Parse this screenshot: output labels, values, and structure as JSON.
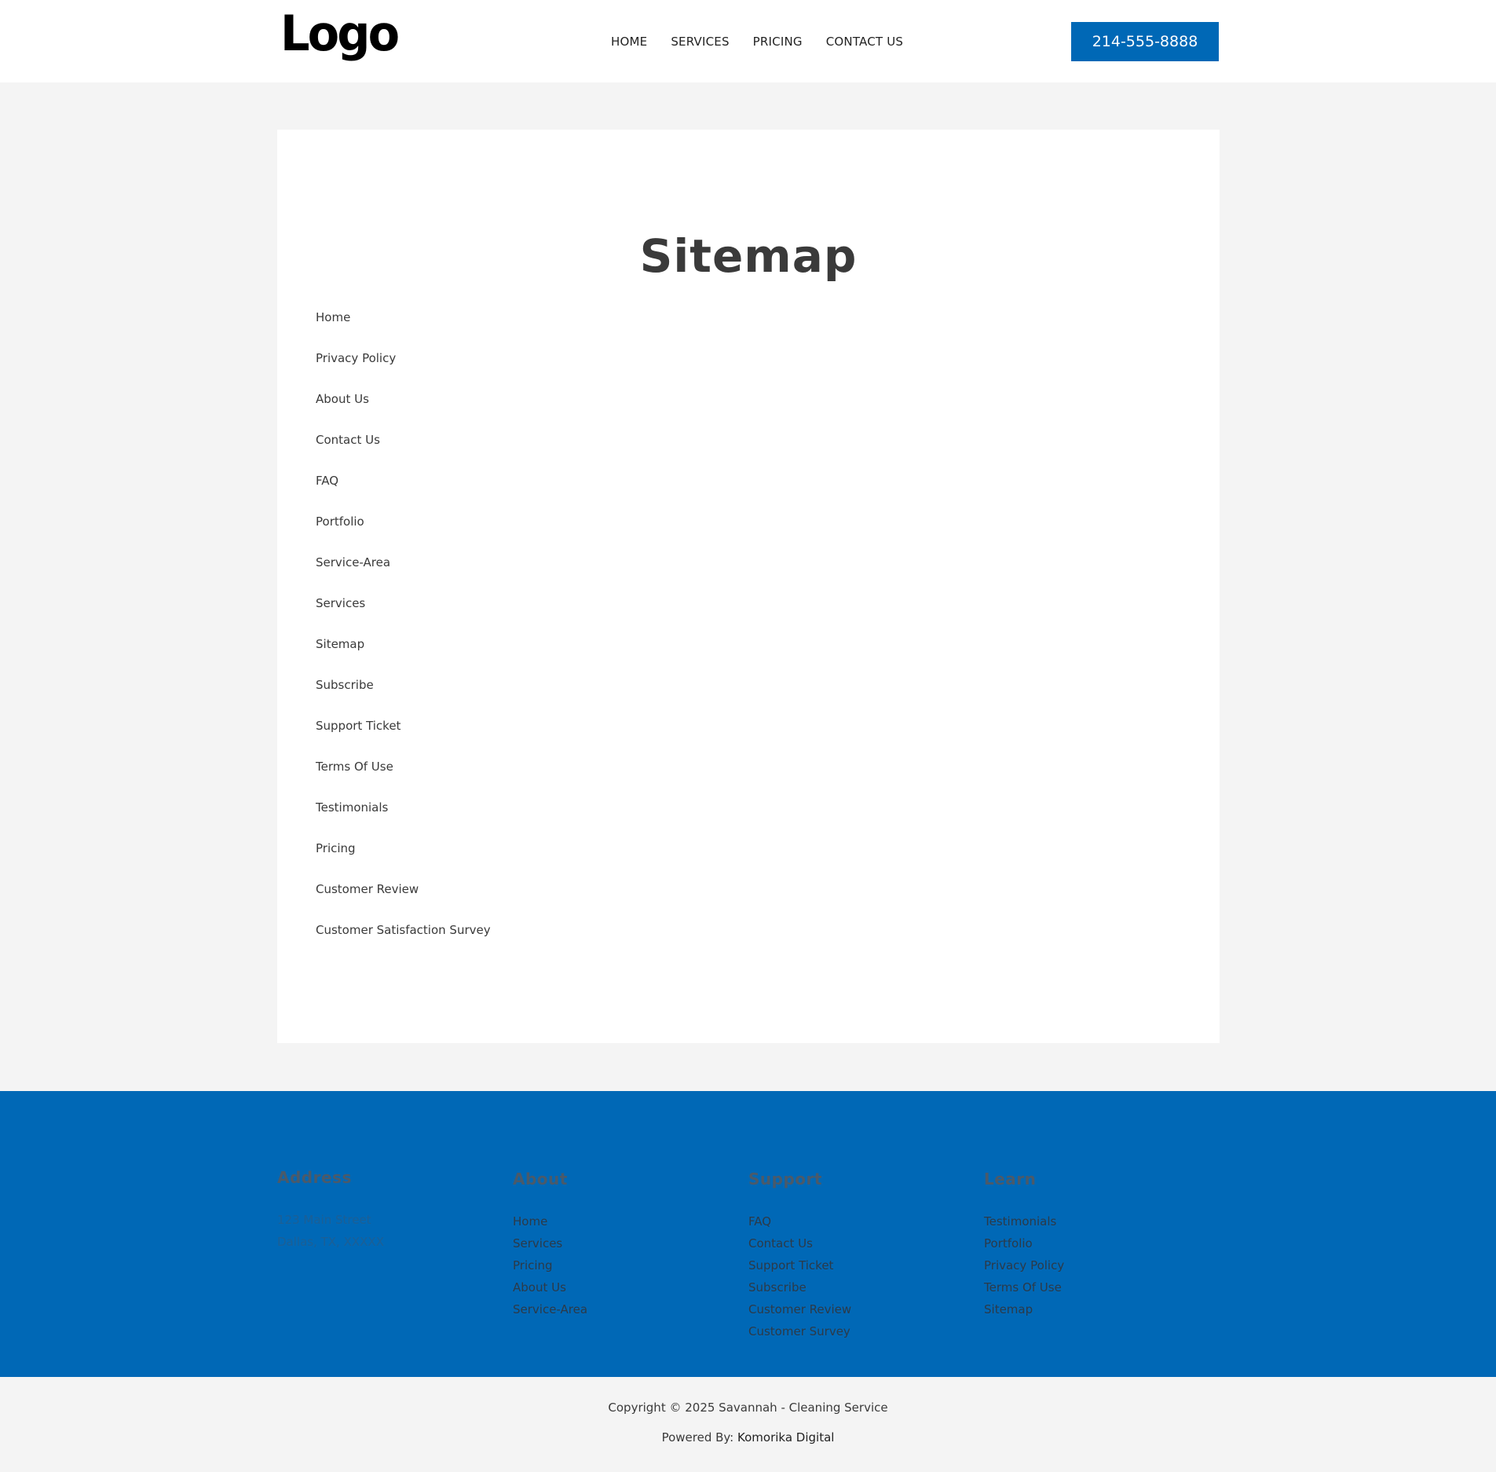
{
  "header": {
    "logo": "Logo",
    "nav": [
      "HOME",
      "SERVICES",
      "PRICING",
      "CONTACT US"
    ],
    "phone": "214-555-8888"
  },
  "main": {
    "title": "Sitemap",
    "links": [
      "Home",
      "Privacy Policy",
      "About Us",
      "Contact Us",
      "FAQ",
      "Portfolio",
      "Service-Area",
      "Services",
      "Sitemap",
      "Subscribe",
      "Support Ticket",
      "Terms Of Use",
      "Testimonials",
      "Pricing",
      "Customer Review",
      "Customer Satisfaction Survey"
    ]
  },
  "footer": {
    "address": {
      "title": "Address",
      "lines": [
        "123 Main Street",
        "Dallas, TX, XXXXX"
      ]
    },
    "about": {
      "title": "About",
      "links": [
        "Home",
        "Services",
        "Pricing",
        "About Us",
        "Service-Area"
      ]
    },
    "support": {
      "title": "Support",
      "links": [
        "FAQ",
        "Contact Us",
        "Support Ticket",
        "Subscribe",
        "Customer Review",
        "Customer Survey"
      ]
    },
    "learn": {
      "title": "Learn",
      "links": [
        "Testimonials",
        "Portfolio",
        "Privacy Policy",
        "Terms Of Use",
        "Sitemap"
      ]
    }
  },
  "bottom": {
    "copyright": "Copyright © 2025 Savannah - Cleaning Service",
    "powered_prefix": "Powered By: ",
    "powered_link": "Komorika Digital"
  },
  "colors": {
    "brand": "#0068b6",
    "page_bg": "#f4f4f4",
    "text": "#3a3a3a"
  }
}
